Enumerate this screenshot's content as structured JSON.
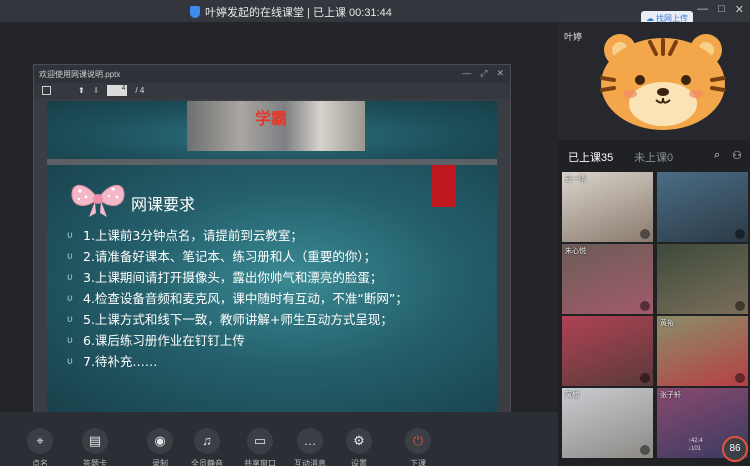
{
  "window": {
    "title": "叶婷发起的在线课堂 | 已上课 00:31:44",
    "min_icon": "minimize-icon",
    "max_icon": "maximize-icon",
    "close_icon": "close-icon",
    "upload_label": "找网上传"
  },
  "ppt": {
    "filename": "欢迎使用网课说明.pptx",
    "page_current": "4",
    "page_total": "/ 4",
    "banner_text": "学霸",
    "heading": "网课要求",
    "bullet_marker": "υ",
    "bullets": [
      "1.上课前3分钟点名，请提前到云教室；",
      "2.请准备好课本、笔记本、练习册和人（重要的你）；",
      "3.上课期间请打开摄像头，露出你帅气和漂亮的脸蛋；",
      "4.检查设备音频和麦克风，课中随时有互动，不准“断网”；",
      "5.上课方式和线下一致，教师讲解+师生互动方式呈现；",
      "6.课后练习册作业在钉钉上传",
      "7.待补充……"
    ]
  },
  "toolbar": {
    "items": [
      {
        "label": "点名",
        "icon": "location-icon"
      },
      {
        "label": "答题卡",
        "icon": "answer-card-icon"
      },
      {
        "label": "录制",
        "icon": "record-icon"
      },
      {
        "label": "全员静音",
        "icon": "mute-all-icon"
      },
      {
        "label": "共享窗口",
        "icon": "share-window-icon"
      },
      {
        "label": "互动消息",
        "icon": "chat-icon"
      },
      {
        "label": "设置",
        "icon": "settings-icon"
      },
      {
        "label": "下课",
        "icon": "power-icon"
      }
    ]
  },
  "panel": {
    "teacher_name": "叶婷",
    "tab_attended": "已上课35",
    "tab_not_attended": "未上课0",
    "students": [
      {
        "name": "云一晴",
        "color1": "#d9d4cc",
        "color2": "#8a7a6e"
      },
      {
        "name": "",
        "color1": "#4a6d85",
        "color2": "#2c3a46"
      },
      {
        "name": "朱心悦",
        "color1": "#6b5d57",
        "color2": "#a35a6a"
      },
      {
        "name": "",
        "color1": "#3d4a3b",
        "color2": "#7a6e5a"
      },
      {
        "name": "",
        "color1": "#b04255",
        "color2": "#5a3a3a"
      },
      {
        "name": "黄裕",
        "color1": "#8a8f6a",
        "color2": "#b73f44"
      },
      {
        "name": "黄楠",
        "color1": "#c9ccd0",
        "color2": "#8d8a86"
      },
      {
        "name": "张子轩",
        "color1": "#8a4a70",
        "color2": "#3a3a60"
      }
    ],
    "net_up": "↑42.4",
    "net_down": "↓101",
    "speed_value": "86"
  }
}
